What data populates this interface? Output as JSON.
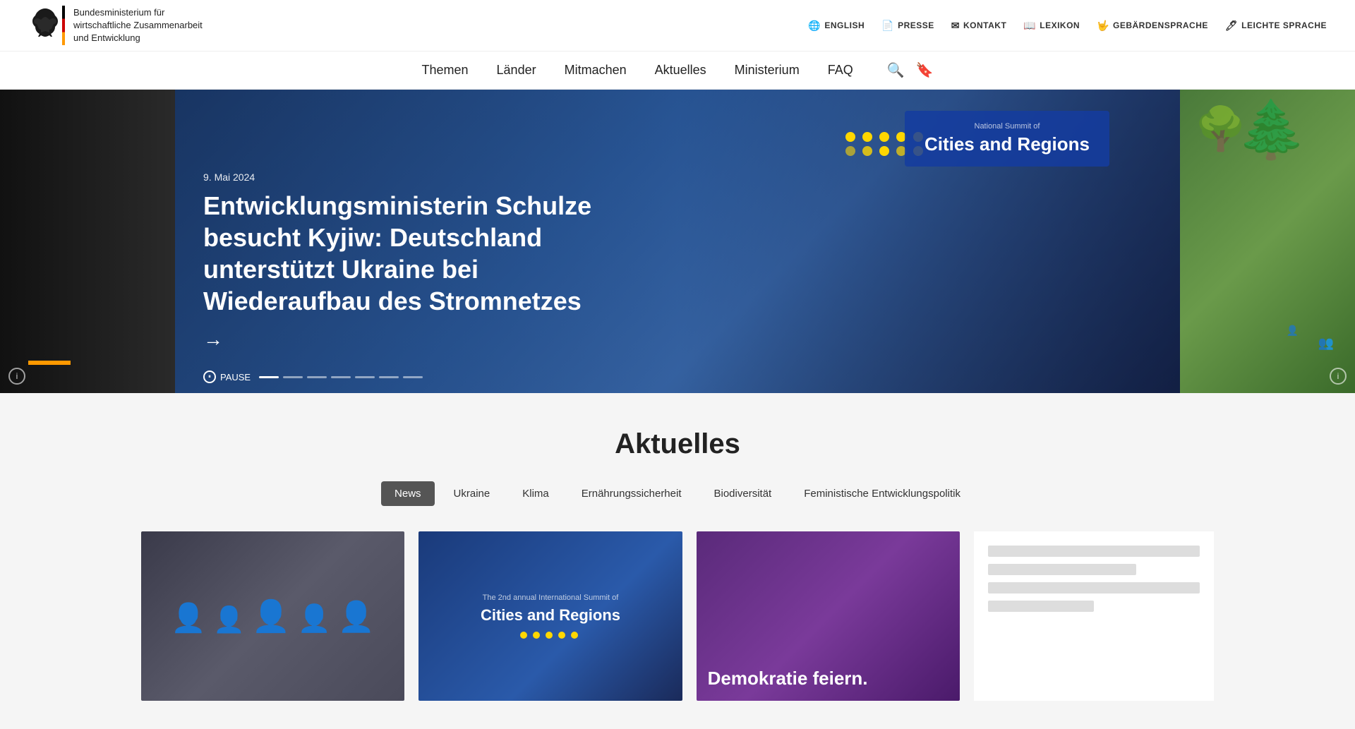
{
  "site": {
    "ministry_name_line1": "Bundesministerium für",
    "ministry_name_line2": "wirtschaftliche Zusammenarbeit",
    "ministry_name_line3": "und Entwicklung"
  },
  "top_bar": {
    "links": [
      {
        "id": "english",
        "label": "ENGLISH",
        "icon": "🌐"
      },
      {
        "id": "presse",
        "label": "PRESSE",
        "icon": "📄"
      },
      {
        "id": "kontakt",
        "label": "KONTAKT",
        "icon": "✉"
      },
      {
        "id": "lexikon",
        "label": "LEXIKON",
        "icon": "📖"
      },
      {
        "id": "gebaerdensprache",
        "label": "GEBÄRDENSPRACHE",
        "icon": "🤟"
      },
      {
        "id": "leichte-sprache",
        "label": "LEICHTE SPRACHE",
        "icon": "🖊"
      }
    ]
  },
  "main_nav": {
    "items": [
      {
        "id": "themen",
        "label": "Themen"
      },
      {
        "id": "laender",
        "label": "Länder"
      },
      {
        "id": "mitmachen",
        "label": "Mitmachen"
      },
      {
        "id": "aktuelles",
        "label": "Aktuelles"
      },
      {
        "id": "ministerium",
        "label": "Ministerium"
      },
      {
        "id": "faq",
        "label": "FAQ"
      }
    ]
  },
  "hero": {
    "date": "9. Mai 2024",
    "title": "Entwicklungsministerin Schulze besucht Kyjiw: Deutschland unterstützt Ukraine bei Wiederaufbau des Stromnetzes",
    "arrow": "→",
    "pause_label": "PAUSE",
    "summit_text_line1": "Cities and Regions",
    "dots_count": 7,
    "active_dot": 0,
    "info_icon_label": "i"
  },
  "aktuelles_section": {
    "title": "Aktuelles",
    "tabs": [
      {
        "id": "news",
        "label": "News",
        "active": true
      },
      {
        "id": "ukraine",
        "label": "Ukraine",
        "active": false
      },
      {
        "id": "klima",
        "label": "Klima",
        "active": false
      },
      {
        "id": "ernaehrungssicherheit",
        "label": "Ernährungssicherheit",
        "active": false
      },
      {
        "id": "biodiversitaet",
        "label": "Biodiversität",
        "active": false
      },
      {
        "id": "feministische",
        "label": "Feministische Entwicklungspolitik",
        "active": false
      }
    ],
    "cards": [
      {
        "id": "card1",
        "img_type": "group-photo",
        "alt": "Group photo at event"
      },
      {
        "id": "card2",
        "img_type": "cities-summit",
        "alt": "Cities and Regions Summit",
        "overlay_text": "The 2nd annual International Summit of Cities and Regions"
      },
      {
        "id": "card3",
        "img_type": "demokratie",
        "alt": "Demokratie feiern",
        "overlay_text": "Demokratie feiern."
      }
    ]
  },
  "sidebar": {
    "lines": [
      {
        "width": "100%",
        "short": false
      },
      {
        "width": "70%",
        "short": true
      },
      {
        "width": "100%",
        "short": false
      },
      {
        "width": "50%",
        "short": true
      }
    ]
  }
}
